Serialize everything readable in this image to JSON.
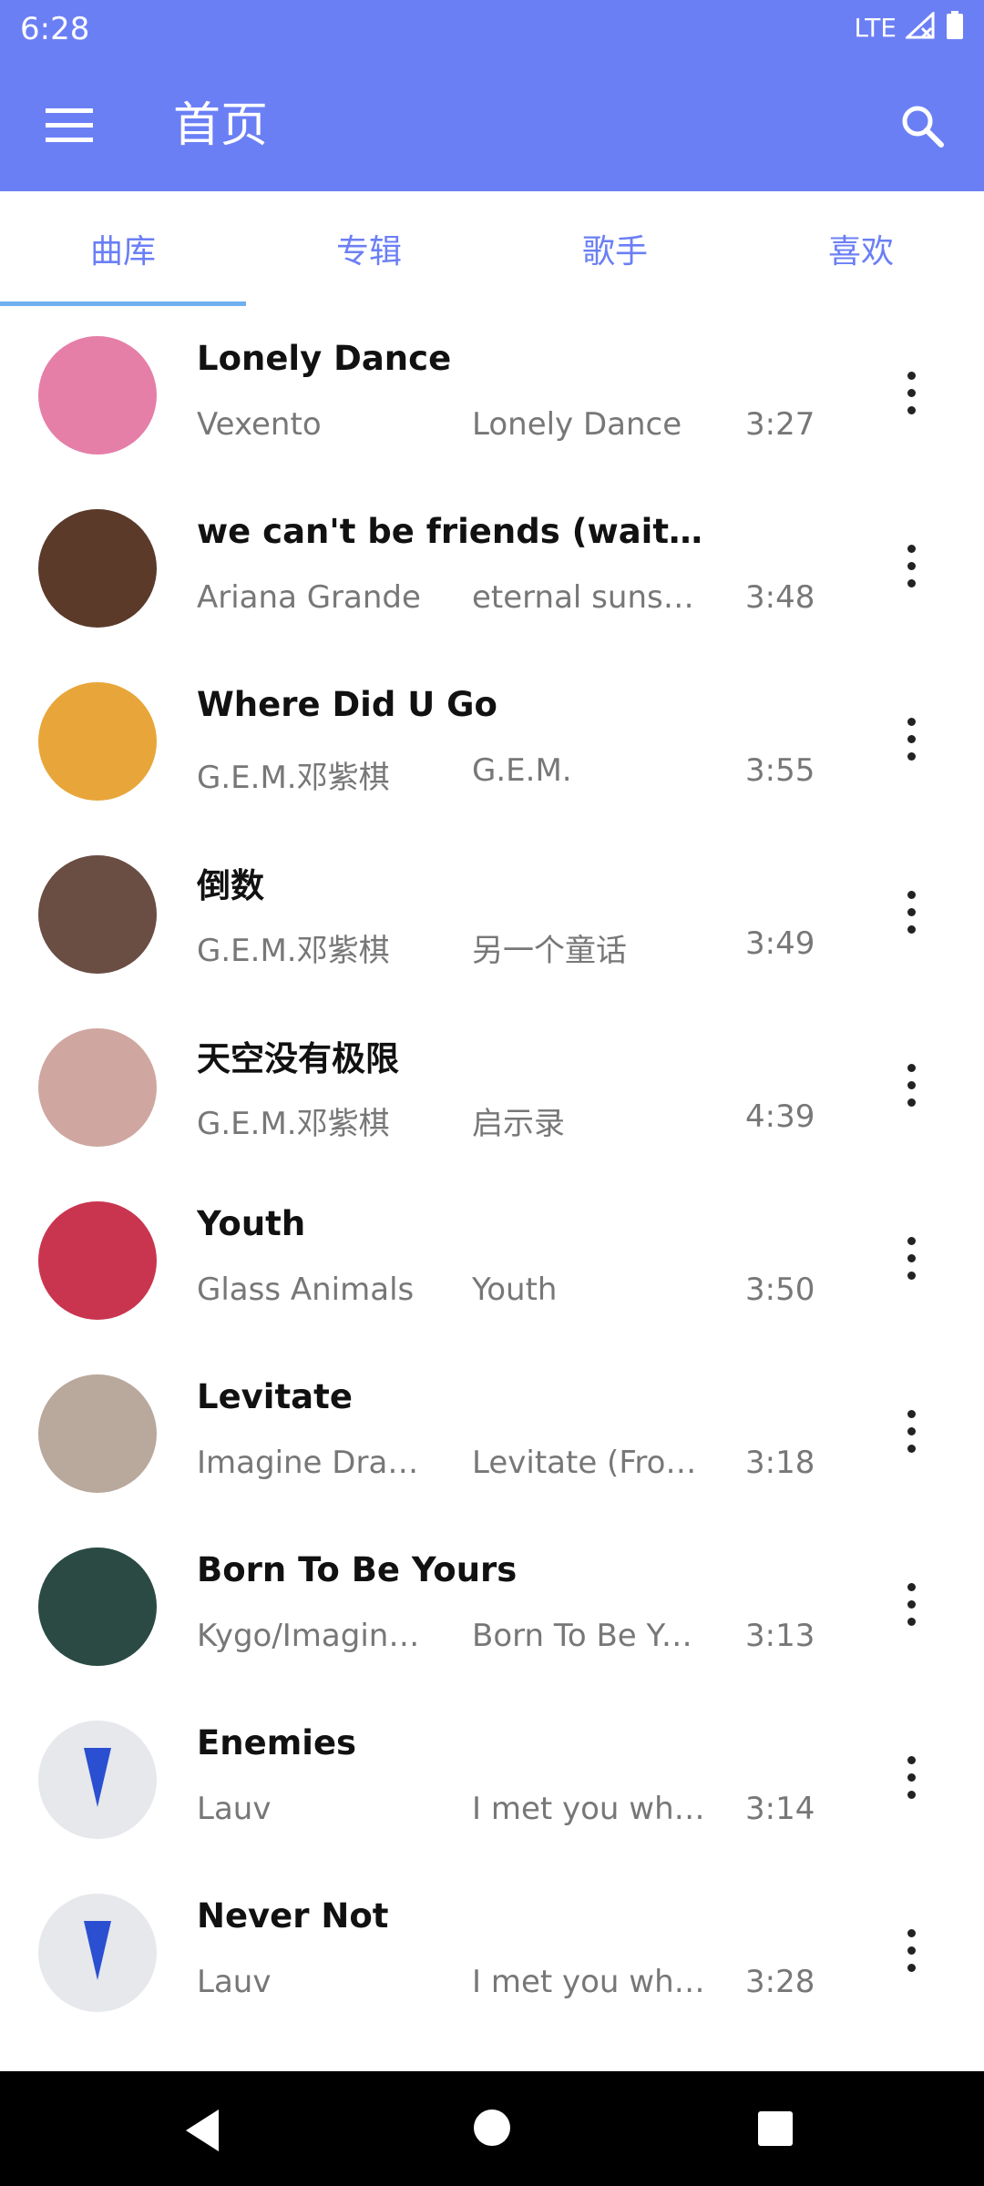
{
  "status": {
    "time": "6:28",
    "network": "LTE"
  },
  "app_bar": {
    "title": "首页"
  },
  "tabs": [
    {
      "label": "曲库",
      "active": true
    },
    {
      "label": "专辑",
      "active": false
    },
    {
      "label": "歌手",
      "active": false
    },
    {
      "label": "喜欢",
      "active": false
    }
  ],
  "songs": [
    {
      "title": "Lonely Dance",
      "artist": "Vexento",
      "album": "Lonely Dance",
      "duration": "3:27",
      "cover_color": "#e57fa8"
    },
    {
      "title": "we can't be friends (wait for y…",
      "artist": "Ariana Grande",
      "album": "eternal sunshi…",
      "duration": "3:48",
      "cover_color": "#5b3a2a"
    },
    {
      "title": "Where Did U Go",
      "artist": "G.E.M.邓紫棋",
      "album": "G.E.M.",
      "duration": "3:55",
      "cover_color": "#e8a63a"
    },
    {
      "title": "倒数",
      "artist": "G.E.M.邓紫棋",
      "album": "另一个童话",
      "duration": "3:49",
      "cover_color": "#6a4d43"
    },
    {
      "title": "天空没有极限",
      "artist": "G.E.M.邓紫棋",
      "album": "启示录",
      "duration": "4:39",
      "cover_color": "#cfa7a0"
    },
    {
      "title": "Youth",
      "artist": "Glass Animals",
      "album": "Youth",
      "duration": "3:50",
      "cover_color": "#c9354f"
    },
    {
      "title": "Levitate",
      "artist": "Imagine Drag…",
      "album": "Levitate (Fro…",
      "duration": "3:18",
      "cover_color": "#b9a89c"
    },
    {
      "title": "Born To Be Yours",
      "artist": "Kygo/Imagine…",
      "album": "Born To Be Yo…",
      "duration": "3:13",
      "cover_color": "#2b4a44"
    },
    {
      "title": "Enemies",
      "artist": "Lauv",
      "album": "I met you whe…",
      "duration": "3:14",
      "cover_color": "#e6e8ec"
    },
    {
      "title": "Never Not",
      "artist": "Lauv",
      "album": "I met you whe…",
      "duration": "3:28",
      "cover_color": "#e6e8ec"
    }
  ],
  "colors": {
    "primary": "#6b7ff5",
    "indicator": "#6fb0ef"
  }
}
